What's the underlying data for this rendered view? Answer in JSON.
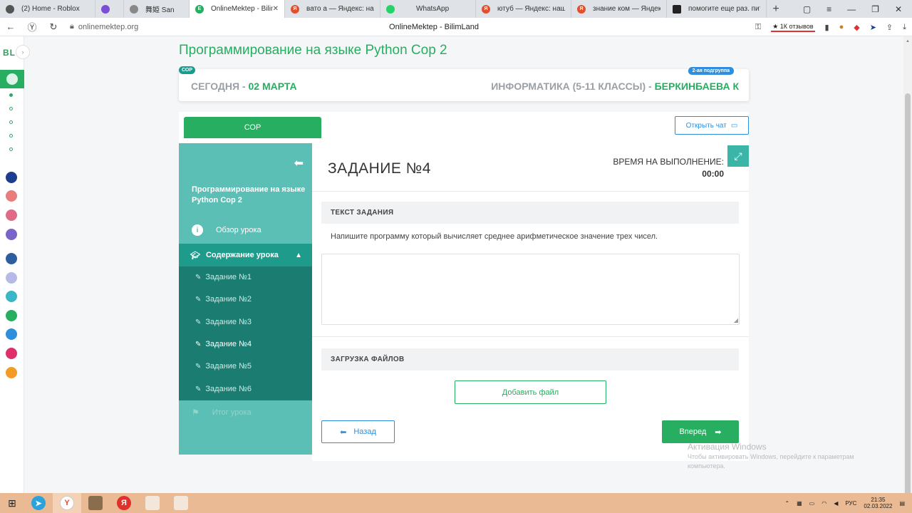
{
  "browser": {
    "tabs": [
      {
        "label": "(2) Home - Roblox",
        "icon": "roblox-icon",
        "color": "#555555"
      },
      {
        "label": "",
        "icon": "chrome-icon",
        "color": "#7a4fd6"
      },
      {
        "label": "舞姫 San",
        "icon": "profile-icon",
        "color": "#888888"
      },
      {
        "label": "OnlineMektep - BilimLa",
        "icon": "onlinemektep-icon",
        "color": "#27ae60",
        "active": true
      },
      {
        "label": "вато а — Яндекс: нашлось",
        "icon": "yandex-icon",
        "color": "#e0502f"
      },
      {
        "label": "WhatsApp",
        "icon": "whatsapp-icon",
        "color": "#25d366"
      },
      {
        "label": "ютуб — Яндекс: нашлось",
        "icon": "yandex-icon",
        "color": "#e0502f"
      },
      {
        "label": "знание ком — Яндекс: на",
        "icon": "yandex-icon",
        "color": "#e0502f"
      },
      {
        "label": "помогите еще раз. питон",
        "icon": "znanija-icon",
        "color": "#222222"
      }
    ],
    "url": "onlinemektep.org",
    "page_title": "OnlineMektep - BilimLand",
    "reviews": "★ 1К отзывов"
  },
  "sidebar_logo": "BL",
  "course_title": "Программирование на языке Python Сор 2",
  "info": {
    "badge_left": "СОР",
    "badge_right": "2-ая подгруппа",
    "today_label": "СЕГОДНЯ - ",
    "today_date": "02 МАРТА",
    "subject_label": "ИНФОРМАТИКА (5-11 КЛАССЫ) - ",
    "teacher": "БЕРКИНБАЕВА К"
  },
  "tab_sor": "СОР",
  "chat_button": "Открыть чат",
  "lesson_sidebar": {
    "title": "Программирование на языке Python Сор 2",
    "overview": "Обзор урока",
    "content_section": "Содержание урока",
    "tasks": [
      "Задание №1",
      "Задание №2",
      "Задание №3",
      "Задание №4",
      "Задание №5",
      "Задание №6"
    ],
    "current_task_index": 3,
    "final": "Итог урока"
  },
  "task": {
    "heading": "ЗАДАНИЕ №4",
    "time_label": "ВРЕМЯ НА ВЫПОЛНЕНИЕ:",
    "time_value": "00:00",
    "text_section": "ТЕКСТ ЗАДАНИЯ",
    "text": "Напишите программу который вычисляет среднее арифметическое значение трех чисел.",
    "answer_value": "",
    "upload_section": "ЗАГРУЗКА ФАЙЛОВ",
    "add_file": "Добавить файл",
    "back": "Назад",
    "next": "Вперед"
  },
  "watermark": {
    "title": "Активация Windows",
    "subtitle": "Чтобы активировать Windows, перейдите к параметрам компьютера."
  },
  "taskbar": {
    "lang": "РУС",
    "time": "21:35",
    "date": "02.03.2022"
  },
  "colors": {
    "accent_green": "#27ae60",
    "teal": "#5bbfb5",
    "teal_dark": "#1b7d72",
    "blue": "#2d8fdd"
  }
}
